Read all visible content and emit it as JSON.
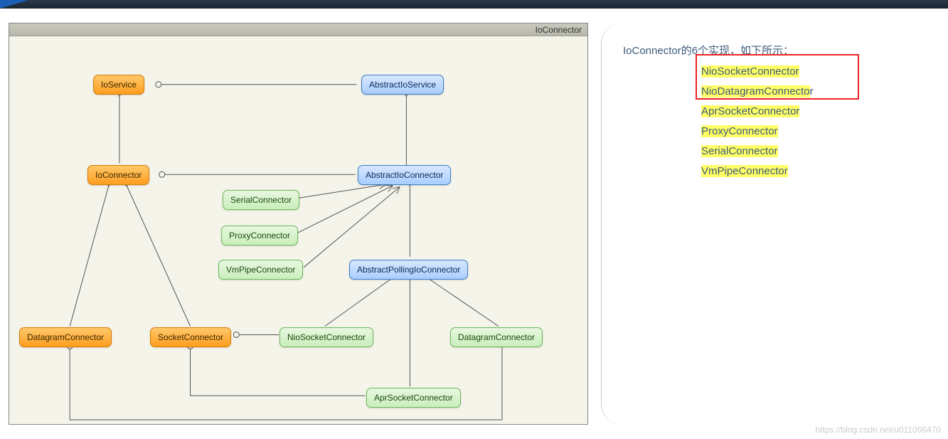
{
  "diagram": {
    "title": "IoConnector",
    "nodes": {
      "ioService": "IoService",
      "ioConnector": "IoConnector",
      "abstractIoService": "AbstractIoService",
      "abstractIoConnector": "AbstractIoConnector",
      "serialConnector": "SerialConnector",
      "proxyConnector": "ProxyConnector",
      "vmPipeConnector": "VmPipeConnector",
      "abstractPolling": "AbstractPollingIoConnector",
      "datagramConnectorL": "DatagramConnector",
      "socketConnectorL": "SocketConnector",
      "nioSocketConnector": "NioSocketConnector",
      "datagramConnectorR": "DatagramConnector",
      "aprSocketConnector": "AprSocketConnector"
    }
  },
  "side": {
    "titlePrefix": "IoConnector",
    "titleSuffix": "的6个实现，如下所示：",
    "impls": [
      {
        "text": "NioSocketConnector",
        "hlLen": 18
      },
      {
        "text": "NioDatagramConnector",
        "hlLen": 19
      },
      {
        "text": "AprSocketConnector",
        "hlLen": 18
      },
      {
        "text": "ProxyConnector",
        "hlLen": 14
      },
      {
        "text": "SerialConnector",
        "hlLen": 15
      },
      {
        "text": "VmPipeConnector",
        "hlLen": 15
      }
    ]
  },
  "watermark": "https://blog.csdn.net/u011066470"
}
